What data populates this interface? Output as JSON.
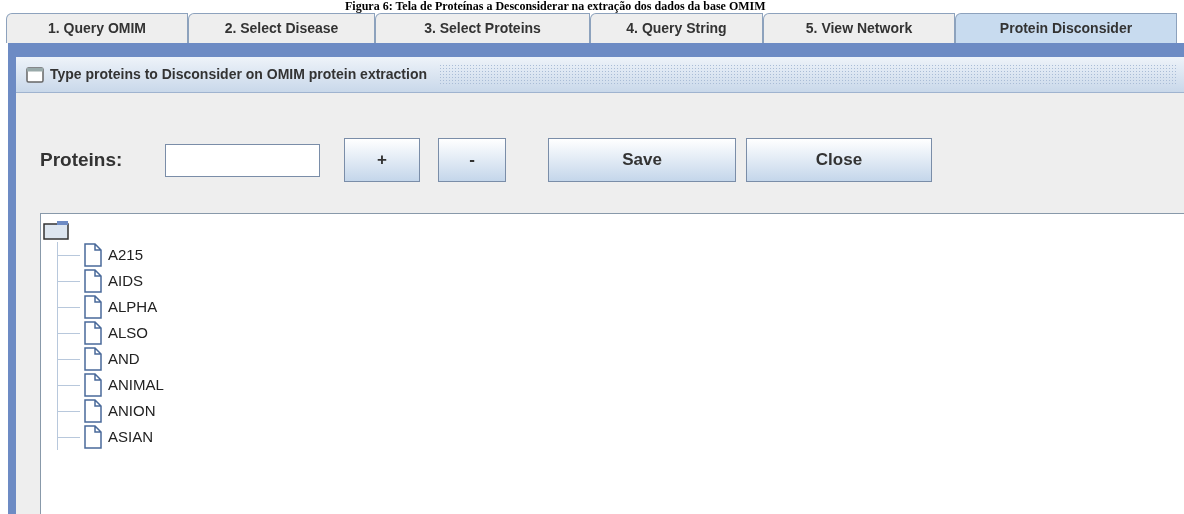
{
  "caption": "Figura 6: Tela de Proteínas a Desconsiderar na extração dos dados da base OMIM",
  "tabs": [
    {
      "label": "1. Query OMIM",
      "selected": false
    },
    {
      "label": "2. Select Disease",
      "selected": false
    },
    {
      "label": "3. Select Proteins",
      "selected": false
    },
    {
      "label": "4. Query String",
      "selected": false
    },
    {
      "label": "5. View Network",
      "selected": false
    },
    {
      "label": "Protein Disconsider",
      "selected": true
    }
  ],
  "frame": {
    "title": "Type proteins to Disconsider on OMIM protein extraction"
  },
  "form": {
    "label": "Proteins:",
    "buttons": [
      "+",
      "-",
      "Save",
      "Close"
    ]
  },
  "tree": {
    "children": [
      {
        "label": "A215"
      },
      {
        "label": "AIDS"
      },
      {
        "label": "ALPHA"
      },
      {
        "label": "ALSO"
      },
      {
        "label": "AND"
      },
      {
        "label": "ANIMAL"
      },
      {
        "label": "ANION"
      },
      {
        "label": "ASIAN"
      }
    ]
  }
}
